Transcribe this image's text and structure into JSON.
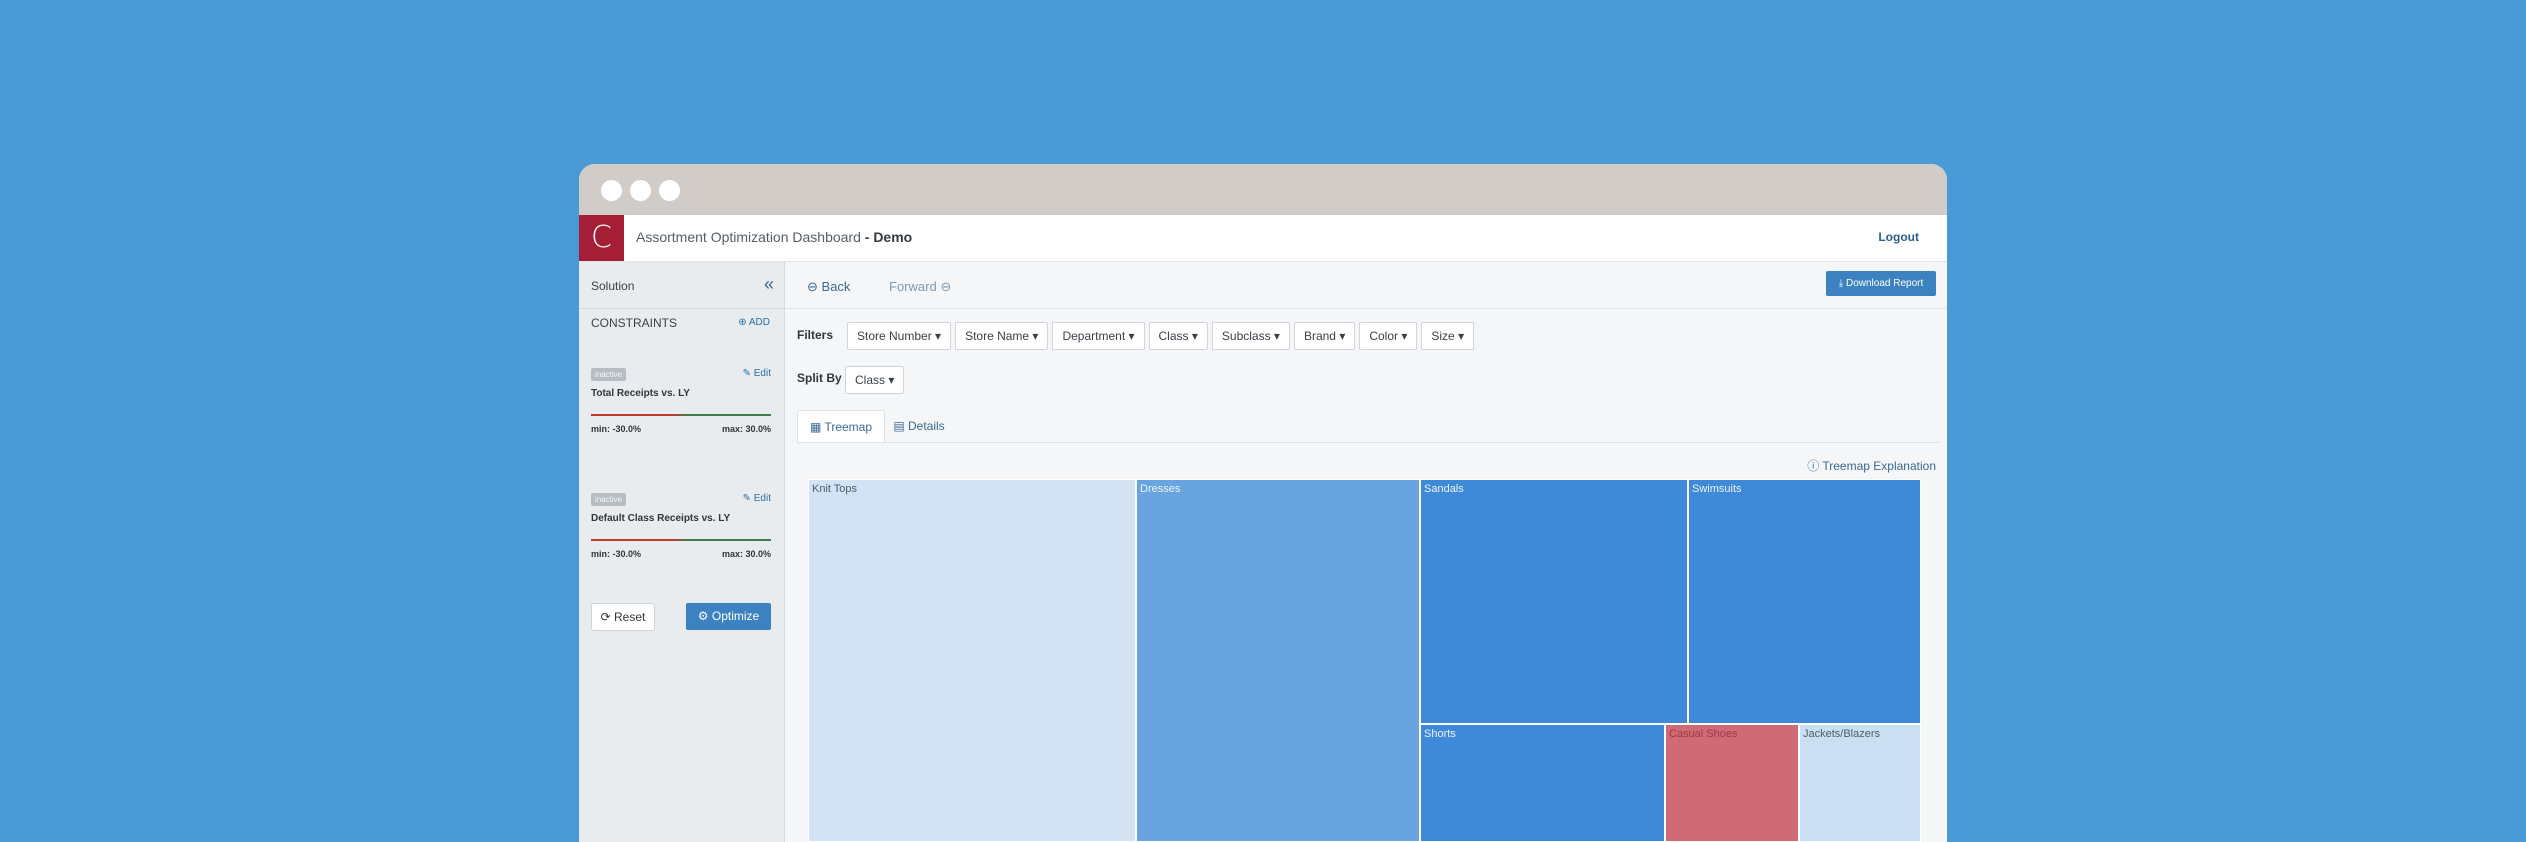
{
  "header": {
    "logo_letter": "C",
    "title": "Assortment Optimization Dashboard",
    "title_suffix": "- Demo",
    "logout": "Logout"
  },
  "sidebar": {
    "title": "Solution",
    "collapse_icon": "double-chevron-left-icon",
    "constraints_label": "CONSTRAINTS",
    "add_label": "ADD",
    "constraints": [
      {
        "badge": "inactive",
        "edit": "Edit",
        "title": "Total Receipts vs. LY",
        "min": "min: -30.0%",
        "max": "max: 30.0%"
      },
      {
        "badge": "inactive",
        "edit": "Edit",
        "title": "Default Class Receipts vs. LY",
        "min": "min: -30.0%",
        "max": "max: 30.0%"
      }
    ],
    "reset": "Reset",
    "optimize": "Optimize"
  },
  "toolbar": {
    "back": "Back",
    "forward": "Forward",
    "download": "Download Report"
  },
  "filters": {
    "label": "Filters",
    "items": [
      "Store Number",
      "Store Name",
      "Department",
      "Class",
      "Subclass",
      "Brand",
      "Color",
      "Size"
    ]
  },
  "split_by": {
    "label": "Split By",
    "value": "Class"
  },
  "tabs": {
    "treemap": "Treemap",
    "details": "Details"
  },
  "treemap": {
    "explanation": "Treemap Explanation",
    "tiles": [
      {
        "label": "Knit Tops",
        "color": "#d4e3f4"
      },
      {
        "label": "Dresses",
        "color": "#67a4e0"
      },
      {
        "label": "Sandals",
        "color": "#3f8ad8"
      },
      {
        "label": "Swimsuits",
        "color": "#3f8ad8"
      },
      {
        "label": "Shorts",
        "color": "#3f8ad8"
      },
      {
        "label": "Casual Shoes",
        "color": "#d06a76"
      },
      {
        "label": "Jackets/Blazers",
        "color": "#cbdff3"
      }
    ]
  }
}
